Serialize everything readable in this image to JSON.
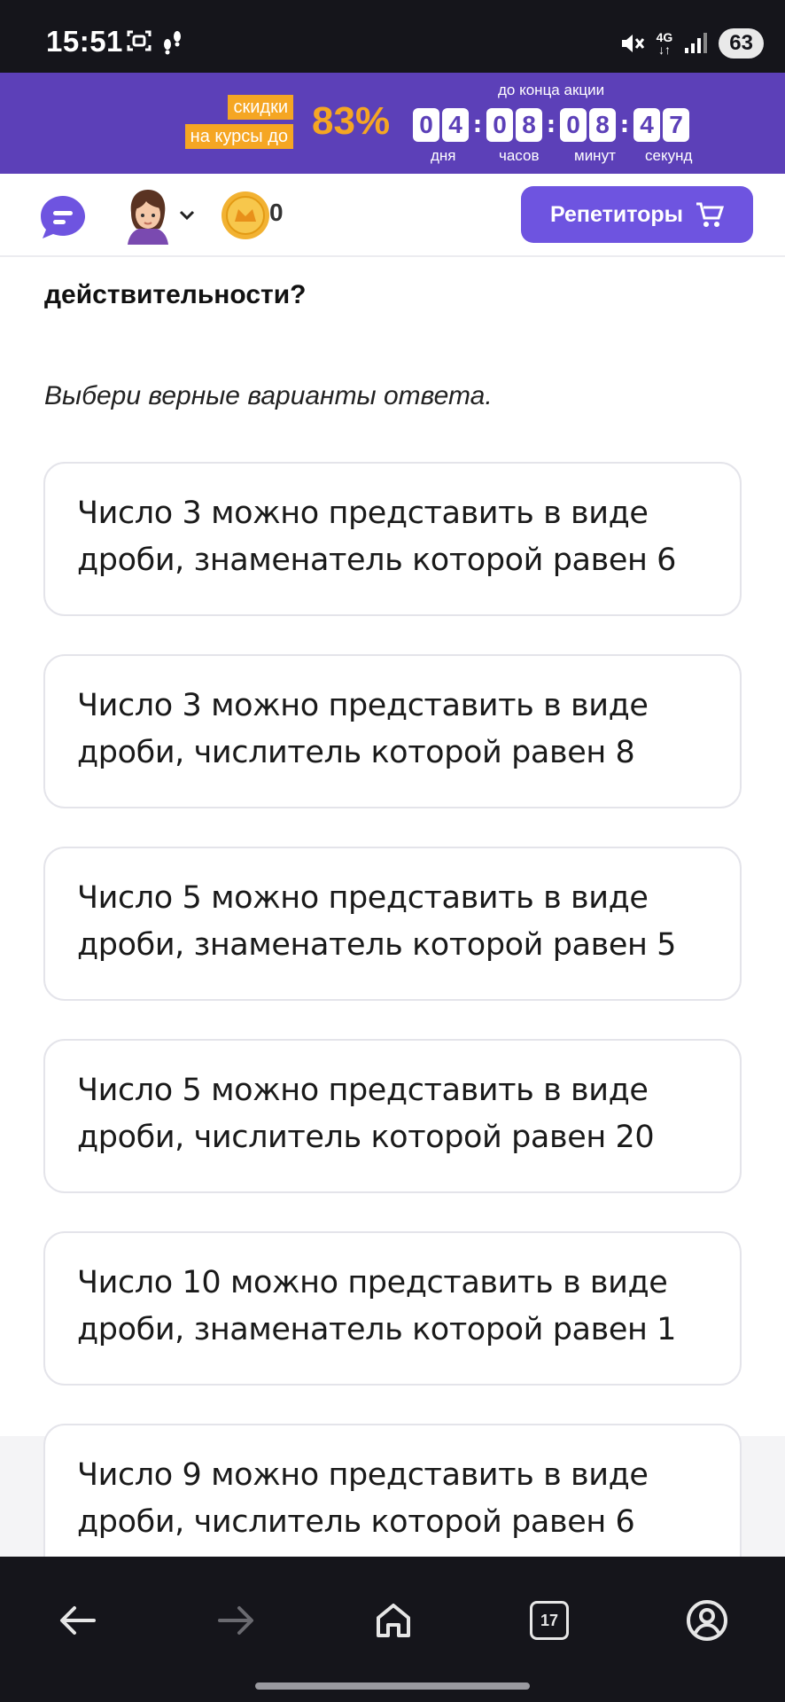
{
  "status_bar": {
    "time": "15:51",
    "network": "4G",
    "battery": "63"
  },
  "promo": {
    "tag_line1": "скидки",
    "tag_line2": "на курсы до",
    "percent": "83%",
    "until_label": "до конца акции",
    "days": [
      "0",
      "4"
    ],
    "hours": [
      "0",
      "8"
    ],
    "minutes": [
      "0",
      "8"
    ],
    "seconds": [
      "4",
      "7"
    ],
    "days_label": "дня",
    "hours_label": "часов",
    "minutes_label": "минут",
    "seconds_label": "секунд",
    "accent_color": "#f5a623",
    "bg_color": "#5c40b8"
  },
  "header": {
    "coins": "0",
    "tutor_button": "Репетиторы",
    "brand_color": "#6e54e0"
  },
  "question": {
    "text_partial": "действительности?",
    "instruction": "Выбери верные варианты ответа."
  },
  "options": [
    {
      "line1": "Число 3 можно представить в виде",
      "line2": "дроби, знаменатель которой равен 6"
    },
    {
      "line1": "Число 3 можно представить в виде",
      "line2": "дроби, числитель которой равен 8"
    },
    {
      "line1": "Число 5 можно представить в виде",
      "line2": "дроби, знаменатель которой равен 5"
    },
    {
      "line1": "Число 5 можно представить в виде",
      "line2": "дроби, числитель которой равен 20"
    },
    {
      "line1": "Число 10 можно представить в виде",
      "line2": "дроби, знаменатель которой равен 1"
    },
    {
      "line1": "Число 9 можно представить в виде",
      "line2": "дроби, числитель которой равен 6"
    }
  ],
  "bottom_nav": {
    "tabs_count": "17",
    "icons": [
      "back-icon",
      "forward-icon",
      "home-icon",
      "tabs-icon",
      "profile-icon"
    ]
  }
}
